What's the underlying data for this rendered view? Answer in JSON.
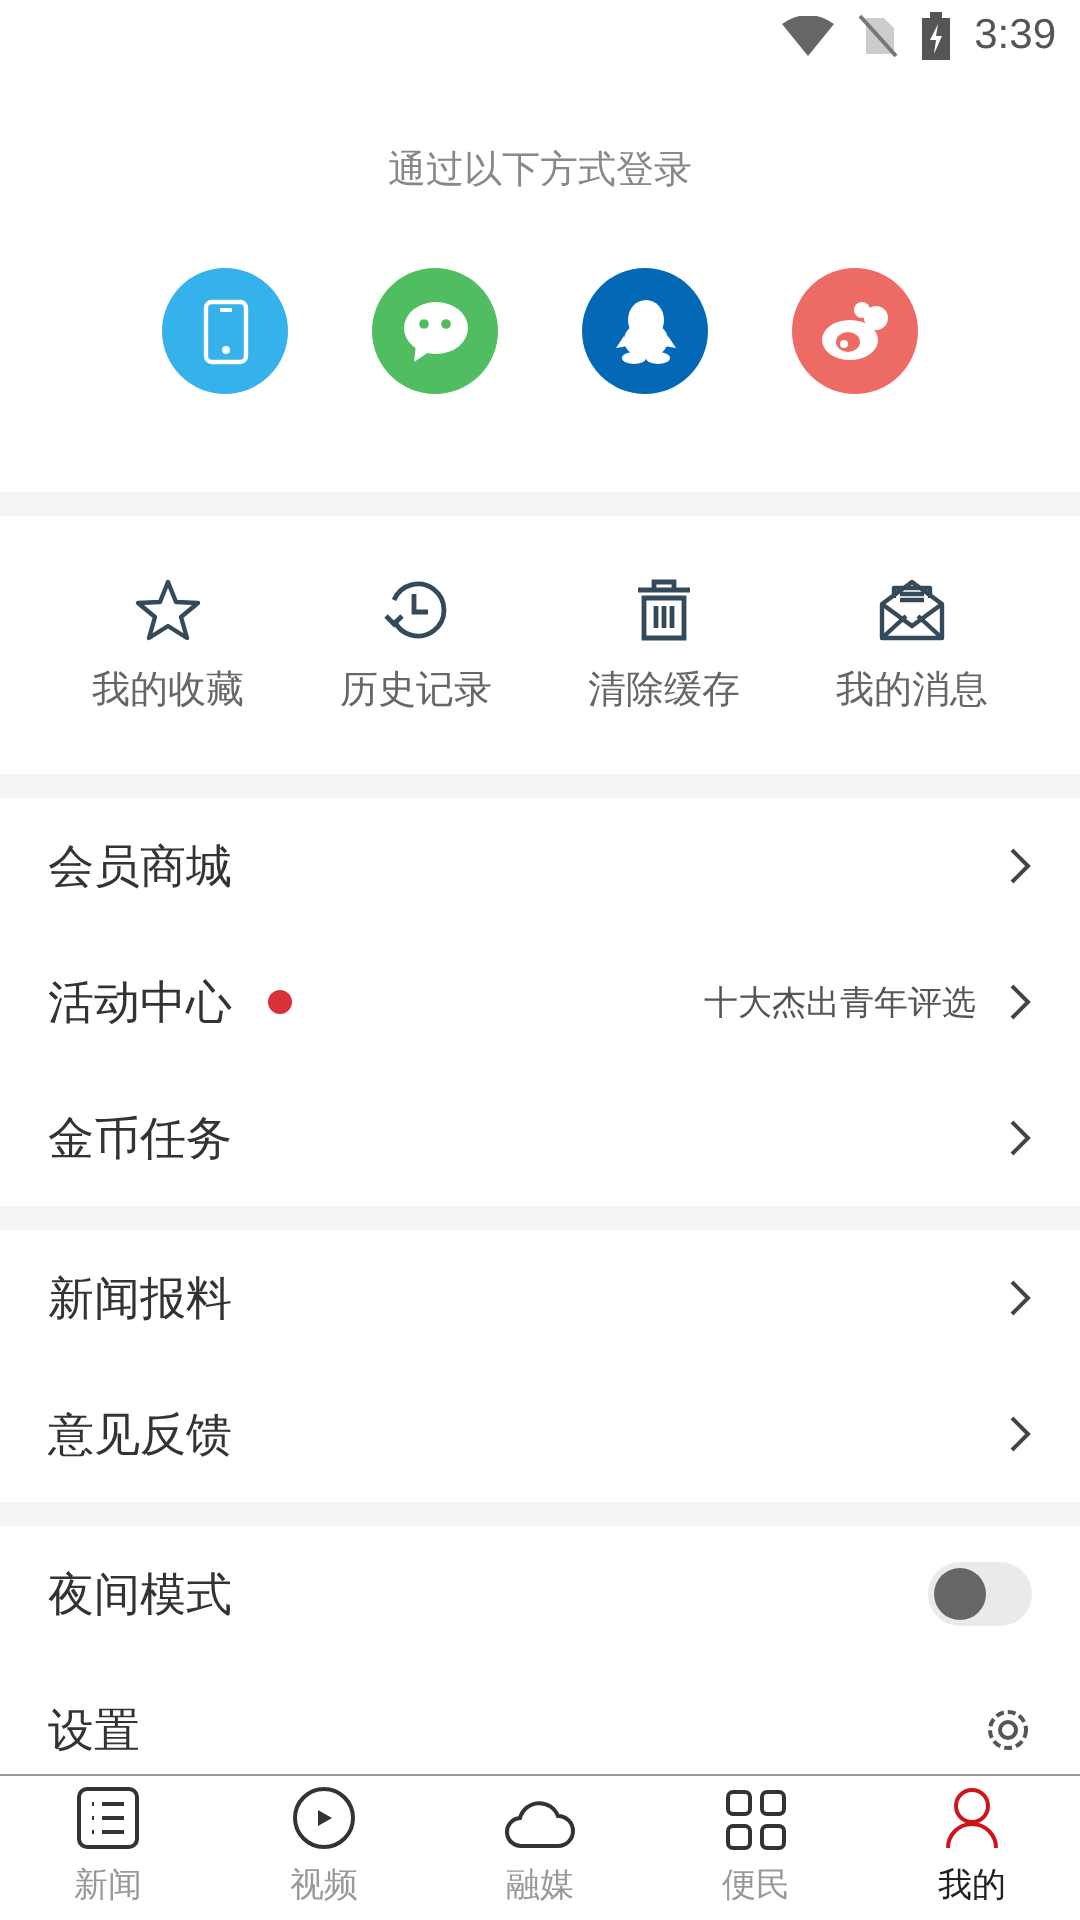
{
  "status_bar": {
    "time": "3:39"
  },
  "login": {
    "title": "通过以下方式登录",
    "methods": [
      {
        "kind": "phone",
        "color": "#35b2ec"
      },
      {
        "kind": "chat",
        "color": "#50be60"
      },
      {
        "kind": "penguin",
        "color": "#0369b7"
      },
      {
        "kind": "eye",
        "color": "#ee6b65"
      }
    ]
  },
  "shortcuts": [
    {
      "kind": "star",
      "label": "我的收藏"
    },
    {
      "kind": "history",
      "label": "历史记录"
    },
    {
      "kind": "trash",
      "label": "清除缓存"
    },
    {
      "kind": "mail",
      "label": "我的消息"
    }
  ],
  "groups": [
    [
      {
        "kind": "link",
        "label": "会员商城"
      },
      {
        "kind": "link",
        "label": "活动中心",
        "color": "#d9303a",
        "value": "十大杰出青年评选"
      },
      {
        "kind": "link",
        "label": "金币任务"
      }
    ],
    [
      {
        "kind": "link",
        "label": "新闻报料"
      },
      {
        "kind": "link",
        "label": "意见反馈"
      }
    ],
    [
      {
        "kind": "toggle",
        "label": "夜间模式",
        "on": false
      },
      {
        "kind": "settings",
        "label": "设置"
      }
    ]
  ],
  "tabs": [
    {
      "kind": "list",
      "label": "新闻",
      "selected": false
    },
    {
      "kind": "play",
      "label": "视频",
      "selected": false
    },
    {
      "kind": "cloud",
      "label": "融媒",
      "selected": false
    },
    {
      "kind": "grid",
      "label": "便民",
      "selected": false
    },
    {
      "kind": "person",
      "label": "我的",
      "selected": true
    }
  ]
}
